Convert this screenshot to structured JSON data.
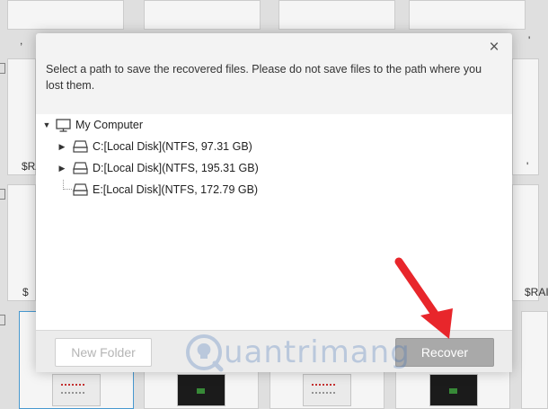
{
  "background": {
    "labels": [
      {
        "text": ",",
        "id": "r1a"
      },
      {
        "text": "'",
        "id": "r1b"
      },
      {
        "text": "$RA",
        "id": "r2a"
      },
      {
        "text": "'",
        "id": "r2b"
      },
      {
        "text": "$",
        "id": "r3a"
      },
      {
        "text": "$RAI",
        "id": "r3b"
      }
    ]
  },
  "dialog": {
    "instruction": "Select a path to save the recovered files. Please do not save files to the path where you lost them.",
    "close_icon": "×",
    "tree": {
      "root_label": "My Computer",
      "drives": [
        {
          "label": "C:[Local Disk](NTFS, 97.31 GB)",
          "expandable": true
        },
        {
          "label": "D:[Local Disk](NTFS, 195.31 GB)",
          "expandable": true
        },
        {
          "label": "E:[Local Disk](NTFS, 172.79 GB)",
          "expandable": false
        }
      ]
    },
    "footer": {
      "new_folder_label": "New Folder",
      "recover_label": "Recover"
    }
  },
  "watermark": {
    "text": "uantrimang",
    "brand": "Quantrimang"
  },
  "colors": {
    "annotation_arrow": "#e8262b",
    "recover_button": "#a9a9a9",
    "selected_tile_border": "#4a9fd8"
  }
}
